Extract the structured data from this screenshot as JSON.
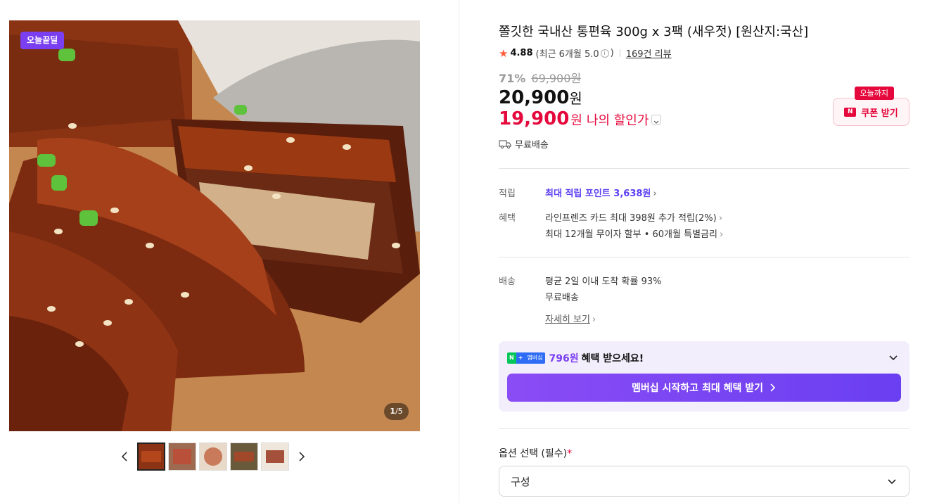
{
  "gallery": {
    "badge": "오늘끝딜",
    "counter_current": "1",
    "counter_total": "/5",
    "thumbnail_count": 5
  },
  "product": {
    "title": "쫄깃한 국내산 통편육 300g x 3팩 (새우젓) [원산지:국산]",
    "rating": "4.88",
    "rating_detail_prefix": "(최근 6개월 5.0",
    "rating_detail_suffix": ")",
    "review_count": "169건 리뷰",
    "discount_rate": "71%",
    "original_price": "69,900원",
    "sale_price": "20,900",
    "price_unit": "원",
    "my_price": "19,900",
    "my_price_unit": "원",
    "my_price_label": "나의 할인가",
    "shipping": "무료배송"
  },
  "coupon": {
    "tag": "오늘까지",
    "logo": "N",
    "label": "쿠폰 받기"
  },
  "details": {
    "points_label": "적립",
    "points_value": "최대 적립 포인트 3,638원",
    "benefit_label": "혜택",
    "benefit_1": "라인프렌즈 카드 최대 398원 추가 적립(2%)",
    "benefit_2": "최대 12개월 무이자 할부 • 60개월 특별금리",
    "delivery_label": "배송",
    "delivery_1": "평균 2일 이내 도착 확률 93%",
    "delivery_2": "무료배송",
    "delivery_more": "자세히 보기"
  },
  "membership": {
    "logo_n": "N",
    "logo_plus": "+",
    "logo_text": "멤버십",
    "amount": "796원",
    "text": "혜택 받으세요!",
    "cta": "멤버십 시작하고 최대 혜택 받기"
  },
  "options": {
    "label": "옵션 선택 (필수)",
    "required_mark": "*",
    "select_value": "구성"
  },
  "colors": {
    "accent_red": "#e5083c",
    "accent_purple": "#7b3ff2",
    "membership_bg": "#f2eefc"
  }
}
